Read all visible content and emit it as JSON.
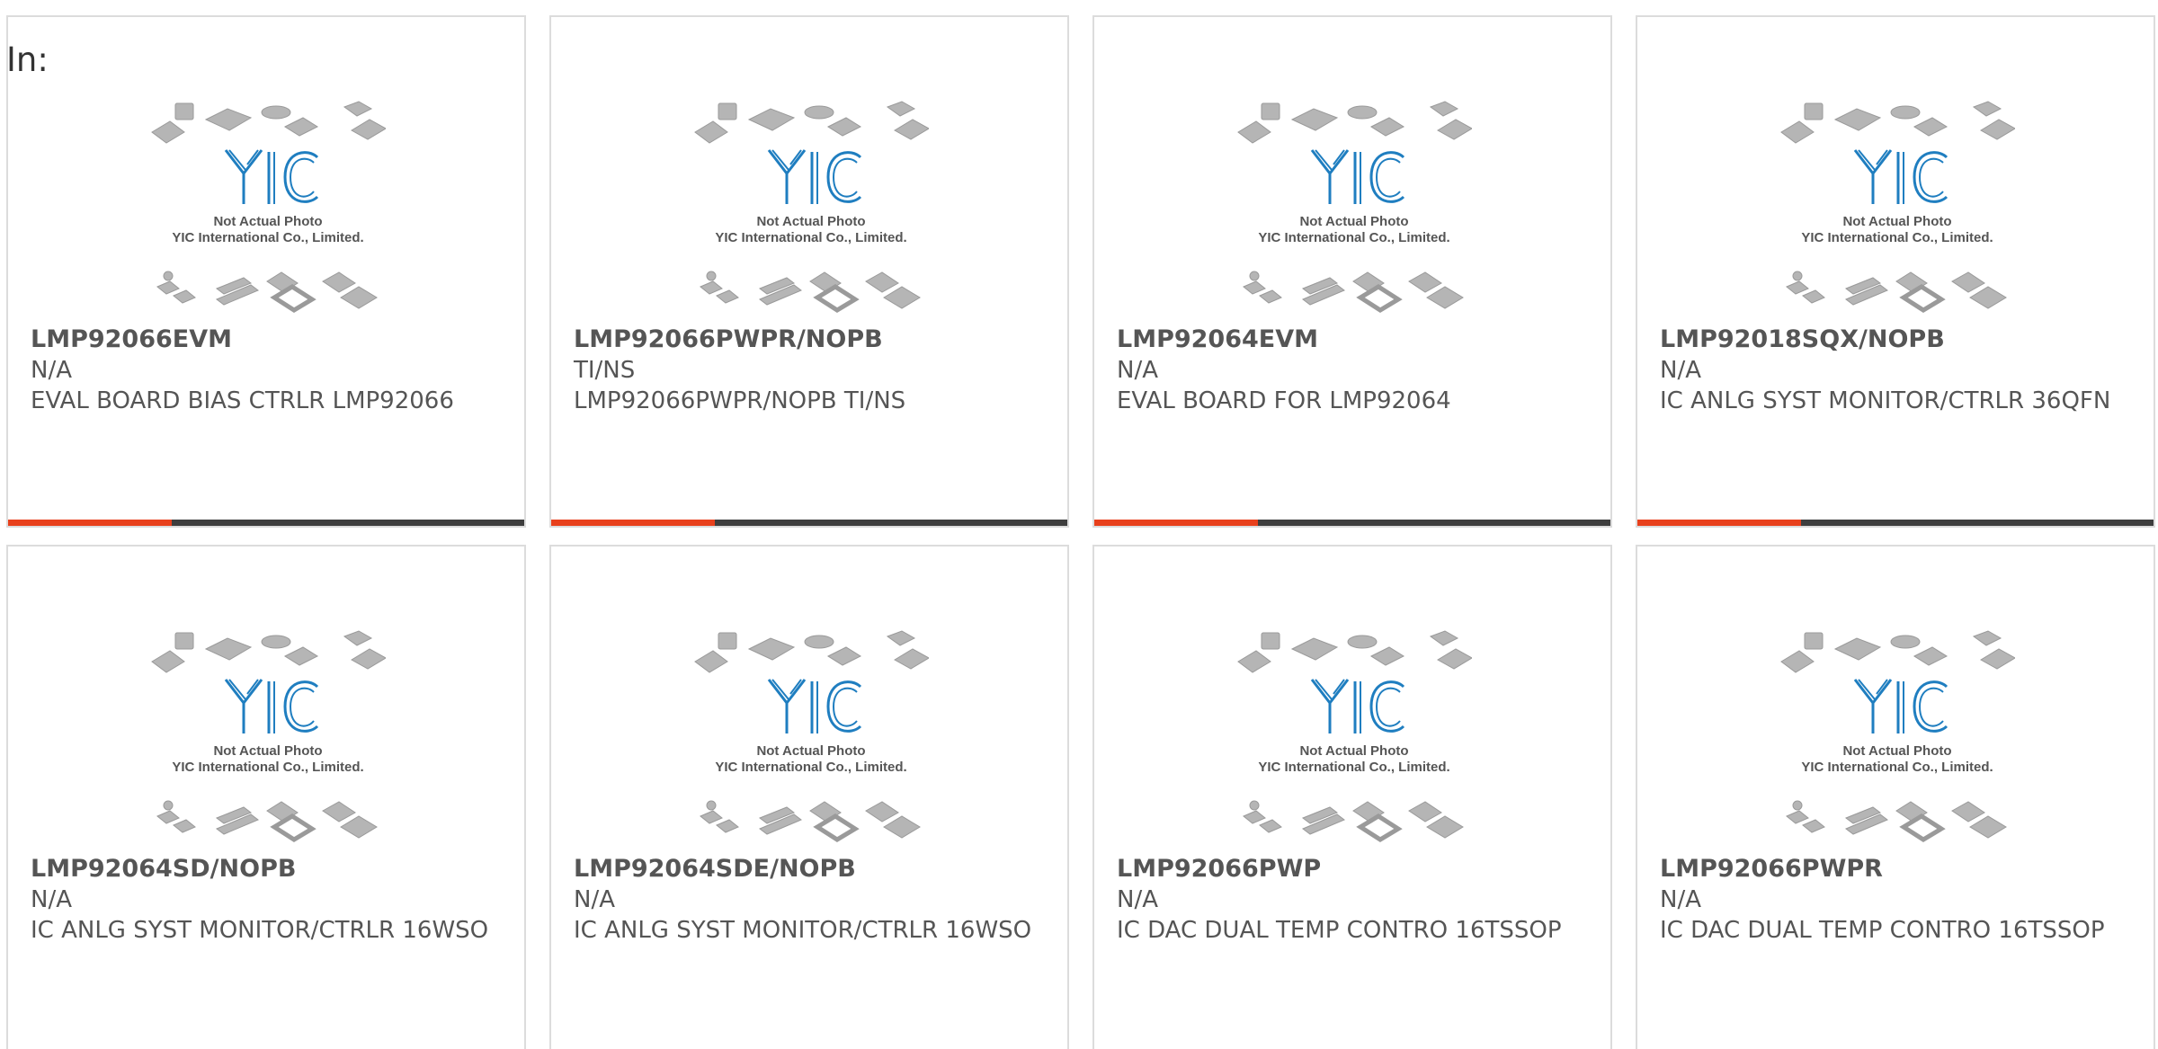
{
  "grid_label": "In:",
  "placeholder": {
    "line1": "Not Actual Photo",
    "line2": "YIC International Co., Limited."
  },
  "accent_color": "#e8401c",
  "bar_color": "#3e3e3e",
  "logo_color": "#1f7ec0",
  "products": [
    {
      "part": "LMP92066EVM",
      "mfr": "N/A",
      "desc": "EVAL BOARD BIAS CTRLR LMP92066"
    },
    {
      "part": "LMP92066PWPR/NOPB",
      "mfr": "TI/NS",
      "desc": "LMP92066PWPR/NOPB TI/NS"
    },
    {
      "part": "LMP92064EVM",
      "mfr": "N/A",
      "desc": "EVAL BOARD FOR LMP92064"
    },
    {
      "part": "LMP92018SQX/NOPB",
      "mfr": "N/A",
      "desc": "IC ANLG SYST MONITOR/CTRLR 36QFN"
    },
    {
      "part": "LMP92064SD/NOPB",
      "mfr": "N/A",
      "desc": "IC ANLG SYST MONITOR/CTRLR 16WSO"
    },
    {
      "part": "LMP92064SDE/NOPB",
      "mfr": "N/A",
      "desc": "IC ANLG SYST MONITOR/CTRLR 16WSO"
    },
    {
      "part": "LMP92066PWP",
      "mfr": "N/A",
      "desc": "IC DAC DUAL TEMP CONTRO 16TSSOP"
    },
    {
      "part": "LMP92066PWPR",
      "mfr": "N/A",
      "desc": "IC DAC DUAL TEMP CONTRO 16TSSOP"
    }
  ]
}
